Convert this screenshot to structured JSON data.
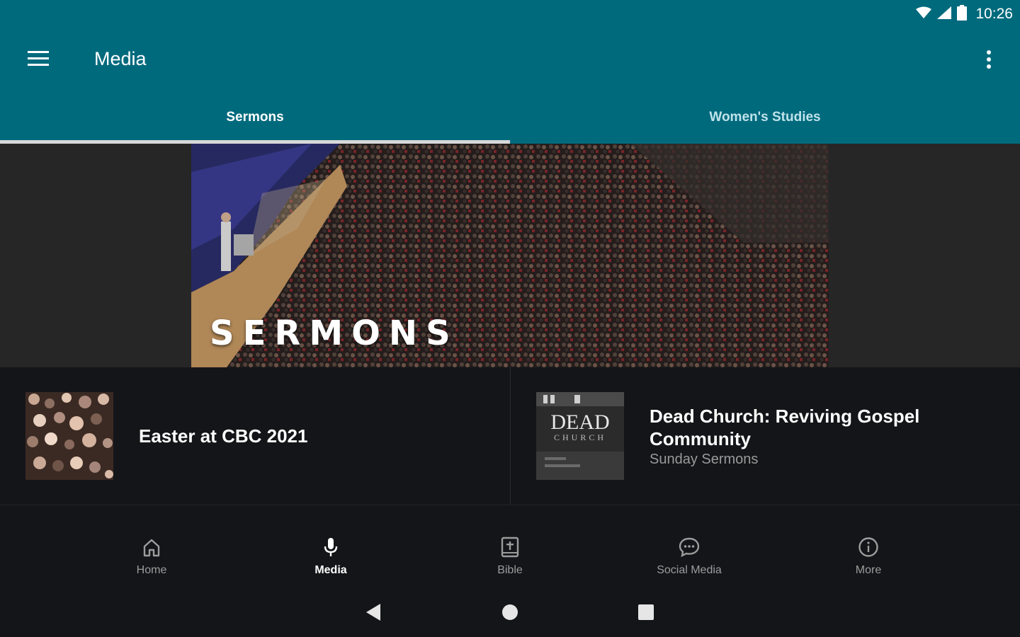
{
  "status": {
    "time": "10:26"
  },
  "appbar": {
    "title": "Media"
  },
  "tabs": [
    {
      "label": "Sermons",
      "active": true
    },
    {
      "label": "Women's Studies",
      "active": false
    }
  ],
  "banner": {
    "title": "SERMONS"
  },
  "cards": [
    {
      "title": "Easter at CBC 2021",
      "subtitle": ""
    },
    {
      "title": "Dead Church: Reviving Gospel Community",
      "subtitle": "Sunday Sermons",
      "thumb_text": "DEAD",
      "thumb_subtext": "CHURCH"
    }
  ],
  "bottom_nav": [
    {
      "label": "Home",
      "icon": "home-icon",
      "active": false
    },
    {
      "label": "Media",
      "icon": "microphone-icon",
      "active": true
    },
    {
      "label": "Bible",
      "icon": "bible-icon",
      "active": false
    },
    {
      "label": "Social Media",
      "icon": "chat-bubble-icon",
      "active": false
    },
    {
      "label": "More",
      "icon": "info-icon",
      "active": false
    }
  ],
  "colors": {
    "primary": "#006a7d",
    "background": "#141518",
    "banner_bg": "#262626"
  }
}
